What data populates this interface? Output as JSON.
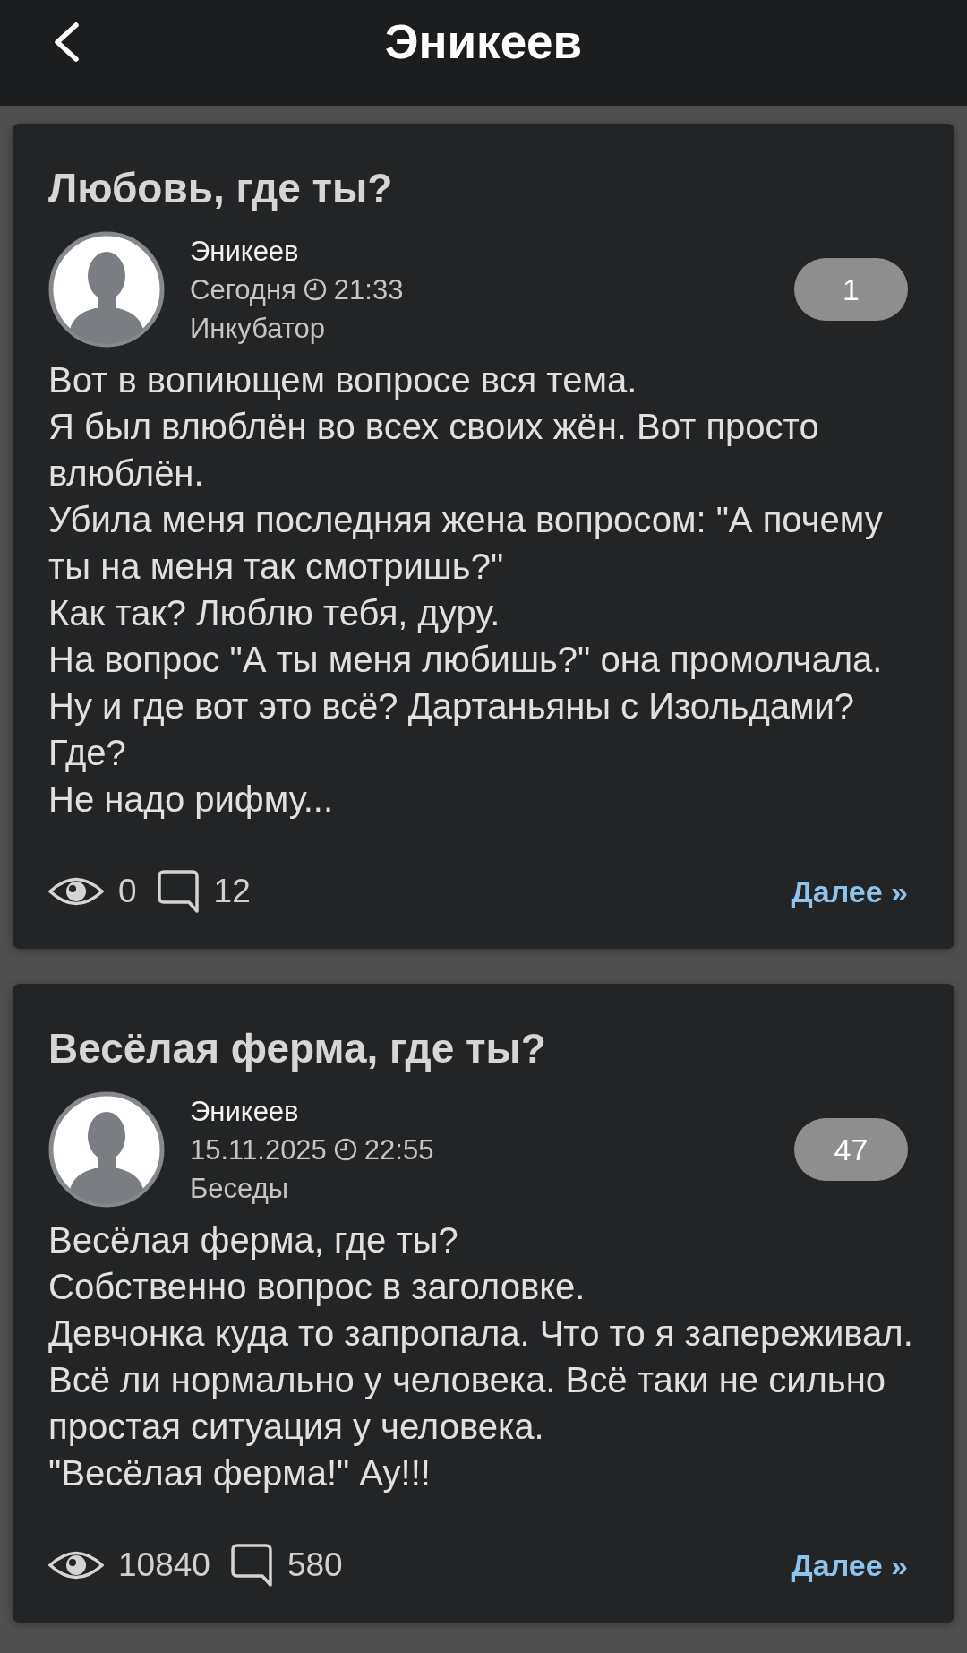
{
  "header": {
    "title": "Эникеев"
  },
  "posts": [
    {
      "title": "Любовь, где ты?",
      "author": "Эникеев",
      "date": "Сегодня",
      "time": "21:33",
      "category": "Инкубатор",
      "count": "1",
      "text": "Вот в вопиющем вопросе вся тема.\nЯ был влюблён во всех своих жён. Вот просто влюблён.\nУбила меня последняя жена вопросом: \"А почему ты на меня так смотришь?\"\nКак так? Люблю тебя, дуру.\nНа вопрос \"А ты меня любишь?\" она промолчала.\nНу и где вот это всё? Дартаньяны с Изольдами? Где?\nНе надо рифму...",
      "views": "0",
      "comments": "12",
      "more_link": "Далее »"
    },
    {
      "title": "Весёлая ферма, где ты?",
      "author": "Эникеев",
      "date": "15.11.2025",
      "time": "22:55",
      "category": "Беседы",
      "count": "47",
      "text": "Весёлая ферма, где ты?\nСобственно вопрос в заголовке.\nДевчонка куда то запропала. Что то я запереживал.\nВсё ли нормально у человека. Всё таки не сильно простая ситуация у человека.\n\"Весёлая ферма!\" Ау!!!",
      "views": "10840",
      "comments": "580",
      "more_link": "Далее »"
    }
  ]
}
